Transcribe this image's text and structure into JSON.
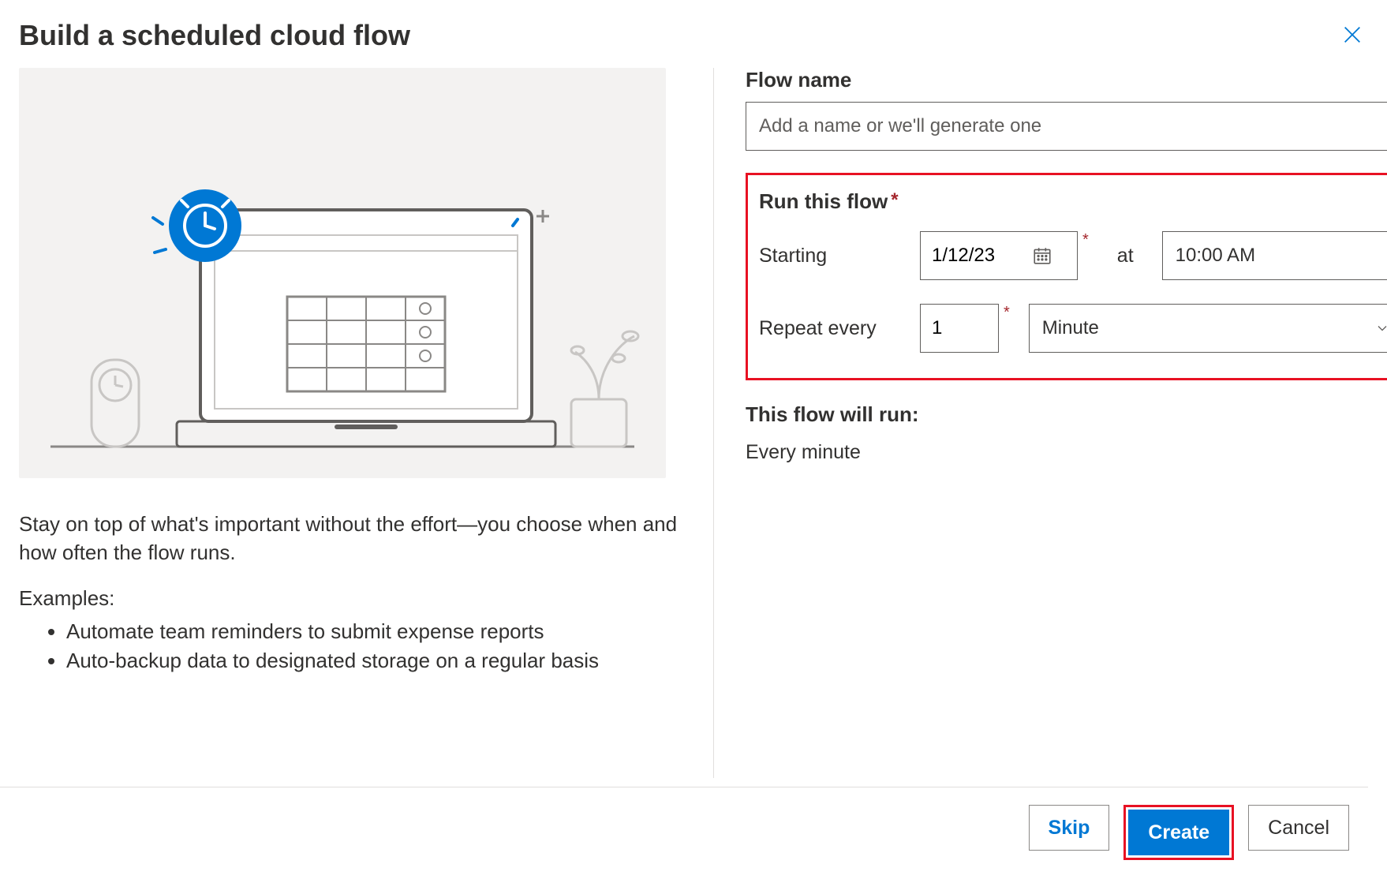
{
  "dialog": {
    "title": "Build a scheduled cloud flow"
  },
  "left": {
    "description": "Stay on top of what's important without the effort—you choose when and how often the flow runs.",
    "examples_label": "Examples:",
    "examples": [
      "Automate team reminders to submit expense reports",
      "Auto-backup data to designated storage on a regular basis"
    ]
  },
  "form": {
    "flow_name_label": "Flow name",
    "flow_name_placeholder": "Add a name or we'll generate one",
    "flow_name_value": "",
    "run_label": "Run this flow",
    "starting_label": "Starting",
    "start_date": "1/12/23",
    "at_label": "at",
    "start_time": "10:00 AM",
    "repeat_label": "Repeat every",
    "repeat_value": "1",
    "repeat_unit": "Minute",
    "summary_label": "This flow will run:",
    "summary_value": "Every minute"
  },
  "footer": {
    "skip": "Skip",
    "create": "Create",
    "cancel": "Cancel"
  },
  "icons": {
    "close": "close",
    "calendar": "calendar",
    "chevron_down": "chevron-down"
  },
  "colors": {
    "primary": "#0078d4",
    "highlight": "#e81123",
    "required": "#a4262c"
  }
}
